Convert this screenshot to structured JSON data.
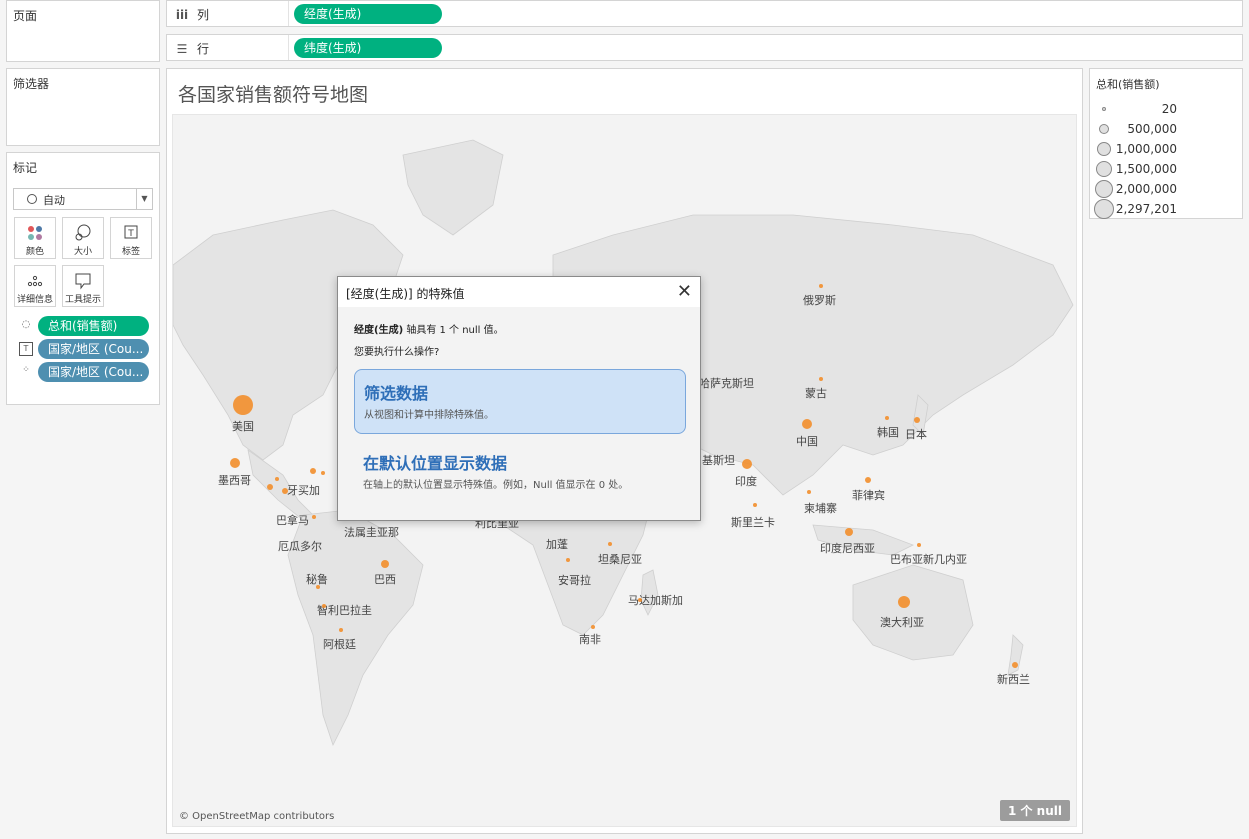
{
  "panels": {
    "pages": "页面",
    "filters": "筛选器",
    "marks": "标记"
  },
  "shelves": {
    "columns": {
      "label": "列",
      "pill": "经度(生成)"
    },
    "rows": {
      "label": "行",
      "pill": "纬度(生成)"
    }
  },
  "marks": {
    "type": "自动",
    "buttons": [
      "颜色",
      "大小",
      "标签",
      "详细信息",
      "工具提示"
    ],
    "fields": [
      "总和(销售额)",
      "国家/地区 (Cou...",
      "国家/地区 (Cou..."
    ]
  },
  "view": {
    "title": "各国家销售额符号地图",
    "attribution": "© OpenStreetMap contributors",
    "null_badge": "1 个 null"
  },
  "legend": {
    "title": "总和(销售额)",
    "values": [
      "20",
      "500,000",
      "1,000,000",
      "1,500,000",
      "2,000,000",
      "2,297,201"
    ]
  },
  "map": {
    "labels": [
      "美国",
      "墨西哥",
      "牙买加",
      "巴拿马",
      "厄瓜多尔",
      "法属圭亚那",
      "秘鲁",
      "巴西",
      "智利巴拉圭",
      "阿根廷",
      "俄罗斯",
      "哈萨克斯坦",
      "蒙古",
      "中国",
      "韩国",
      "日本",
      "基斯坦",
      "印度",
      "菲律宾",
      "柬埔寨",
      "斯里兰卡",
      "印度尼西亚",
      "巴布亚新几内亚",
      "澳大利亚",
      "新西兰",
      "利比里亚",
      "加蓬",
      "坦桑尼亚",
      "安哥拉",
      "马达加斯加",
      "南非"
    ],
    "dot_color": "#f28e2b"
  },
  "dialog": {
    "title": "[经度(生成)] 的特殊值",
    "msg_field": "经度(生成)",
    "msg_rest": " 轴具有 1 个 null 值。",
    "msg2": "您要执行什么操作?",
    "option1_title": "筛选数据",
    "option1_desc": "从视图和计算中排除特殊值。",
    "option2_title": "在默认位置显示数据",
    "option2_desc": "在轴上的默认位置显示特殊值。例如，Null 值显示在 0 处。"
  }
}
